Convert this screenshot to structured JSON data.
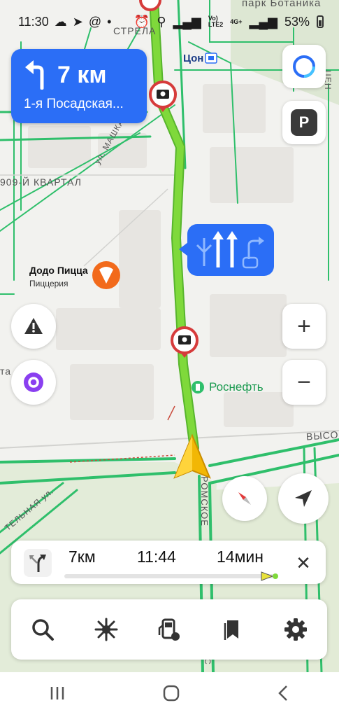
{
  "status_bar": {
    "time": "11:30",
    "signal_small_top": "Vo)",
    "signal_small_bottom": "LTE2",
    "network": "4G+",
    "battery": "53%"
  },
  "map": {
    "labels": {
      "park": "парк Ботаника",
      "strela": "СТРЕЛА",
      "tson": "Цон",
      "kvartal": "909-Й КВАРТАЛ",
      "mashkarina": "ул. МАШКАРИНА",
      "rosneft": "Роснефть",
      "vysoc": "ВЫСО",
      "romskoe": "РОМСКОЕ",
      "telnaya": "ТЕЛЬНАЯ ул.",
      "cent": "ЦЕН",
      "ta": "та",
      "s": "С"
    },
    "poi": {
      "name": "Додо Пицца",
      "category": "Пиццерия"
    }
  },
  "navigation": {
    "distance": "7 км",
    "street": "1-я Посадская..."
  },
  "route_summary": {
    "distance": "7км",
    "arrival": "11:44",
    "duration": "14мин",
    "progress": 0.02
  },
  "colors": {
    "route": "#7fd93b",
    "accent": "#2b6ef6",
    "road": "#2fbf6b"
  }
}
